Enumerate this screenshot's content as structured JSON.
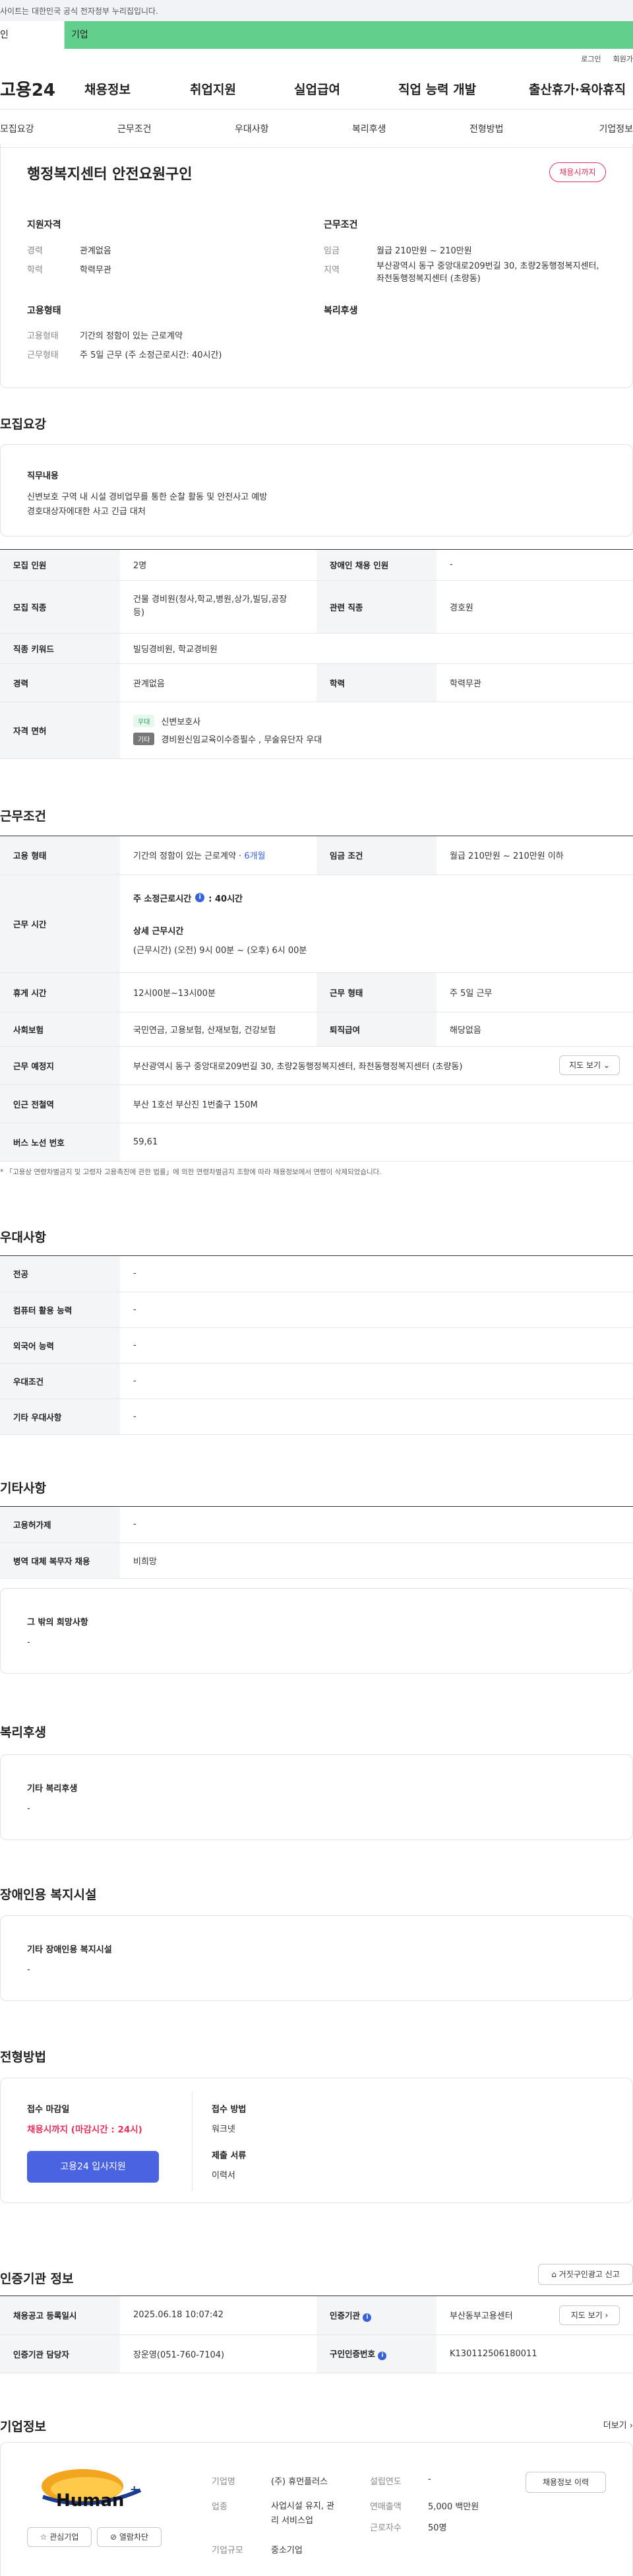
{
  "topbar": {
    "notice": "사이트는 대한민국 공식 전자정부 누리집입니다."
  },
  "gnb": {
    "tab1": "인",
    "tab2": "기업"
  },
  "util": {
    "login": "로그인",
    "join": "회원가"
  },
  "mainnav": {
    "logo": "고용24",
    "items": [
      "채용정보",
      "취업지원",
      "실업급여",
      "직업 능력 개발",
      "출산휴가·육아휴직"
    ]
  },
  "subnav": {
    "items": [
      "모집요강",
      "근무조건",
      "우대사항",
      "복리후생",
      "전형방법",
      "기업정보"
    ]
  },
  "job": {
    "title": "행정복지센터 안전요원구인",
    "badge": "채용시까지",
    "qual_head": "지원자격",
    "career_label": "경력",
    "career": "관계없음",
    "edu_label": "학력",
    "edu": "학력무관",
    "cond_head": "근무조건",
    "wage_label": "임금",
    "wage": "월급 210만원 ~ 210만원",
    "loc_label": "지역",
    "loc": "부산광역시 동구 중앙대로209번길 30, 초량2동행정복지센터, 좌천동행정복지센터 (초량동)",
    "emp_head": "고용형태",
    "emptype_label": "고용형태",
    "emptype": "기간의 정함이 있는 근로계약",
    "worktype_label": "근무형태",
    "worktype": "주 5일 근무 (주 소정근로시간: 40시간)",
    "welfare_head": "복리후생"
  },
  "recruit": {
    "title": "모집요강",
    "duty_head": "직무내용",
    "duty_line1": "신변보호 구역 내 시설 경비업무를 통한 순찰 활동 및 안전사고 예방",
    "duty_line2": "경호대상자에대한 사고 긴급 대처",
    "r1": {
      "k1": "모집 인원",
      "v1": "2명",
      "k2": "장애인 채용 인원",
      "v2": "-"
    },
    "r2": {
      "k1": "모집 직종",
      "v1a": "건물 경비원(청사,학교,병원,상가,빌딩,공장",
      "v1b": "등)",
      "k2": "관련 직종",
      "v2": "경호원"
    },
    "r3": {
      "k1": "직종 키워드",
      "v1": "빌딩경비원, 학교경비원"
    },
    "r4": {
      "k1": "경력",
      "v1": "관계없음",
      "k2": "학력",
      "v2": "학력무관"
    },
    "r5": {
      "k1": "자격 면허",
      "tag1": "우대",
      "lic1": "신변보호사",
      "tag2": "기타",
      "lic2": "경비원신임교육이수증필수 , 무술유단자 우대"
    }
  },
  "work": {
    "title": "근무조건",
    "r1": {
      "k1": "고용 형태",
      "v1": "기간의 정함이 있는 근로계약 · ",
      "v1b": "6개월",
      "k2": "임금 조건",
      "v2": "월급 210만원 ~ 210만원 이하"
    },
    "r2": {
      "k1": "근무 시간",
      "h1": "주 소정근로시간",
      "h1v": ": 40시간",
      "h2": "상세 근무시간",
      "h2v": "(근무시간) (오전) 9시 00분 ~ (오후) 6시 00분"
    },
    "r3": {
      "k1": "휴게 시간",
      "v1": "12시00분~13시00분",
      "k2": "근무 형태",
      "v2": "주 5일 근무"
    },
    "r4": {
      "k1": "사회보험",
      "v1": "국민연금, 고용보험, 산재보험, 건강보험",
      "k2": "퇴직급여",
      "v2": "해당없음"
    },
    "r5": {
      "k1": "근무 예정지",
      "v1": "부산광역시 동구 중앙대로209번길 30, 초량2동행정복지센터, 좌천동행정복지센터 (초량동)",
      "btn": "지도 보기"
    },
    "r6": {
      "k1": "인근 전철역",
      "v1": "부산 1호선 부산진 1번출구 150M"
    },
    "r7": {
      "k1": "버스 노선 번호",
      "v1": "59,61"
    },
    "note": "* 「고용상 연령차별금지 및 고령자 고용촉진에 관한 법률」에 의한 연령차별금지 조항에 따라 채용정보에서 연령이 삭제되었습니다."
  },
  "pref": {
    "title": "우대사항",
    "rows": [
      {
        "k": "전공",
        "v": "-"
      },
      {
        "k": "컴퓨터 활용 능력",
        "v": "-"
      },
      {
        "k": "외국어 능력",
        "v": "-"
      },
      {
        "k": "우대조건",
        "v": "-"
      },
      {
        "k": "기타 우대사항",
        "v": "-"
      }
    ]
  },
  "etc": {
    "title": "기타사항",
    "rows": [
      {
        "k": "고용허가제",
        "v": "-"
      },
      {
        "k": "병역 대체 복무자 채용",
        "v": "비희망"
      }
    ],
    "wish_head": "그 밖의 희망사항",
    "wish": "-"
  },
  "welfare": {
    "title": "복리후생",
    "head": "기타 복리후생",
    "value": "-"
  },
  "disab": {
    "title": "장애인용 복지시설",
    "head": "기타 장애인용 복지시설",
    "value": "-"
  },
  "selection": {
    "title": "전형방법",
    "deadline_head": "접수 마감일",
    "deadline": "채용시까지 (마감시간 : 24시)",
    "apply_btn": "고용24 입사지원",
    "method_head": "접수 방법",
    "method": "워크넷",
    "docs_head": "제출 서류",
    "docs": "이력서"
  },
  "cert": {
    "title": "인증기관 정보",
    "report_btn": "거짓구인광고 신고",
    "r1": {
      "k1": "채용공고 등록일시",
      "v1": "2025.06.18 10:07:42",
      "k2": "인증기관",
      "v2": "부산동부고용센터",
      "btn": "지도 보기"
    },
    "r2": {
      "k1": "인증기관 담당자",
      "v1": "장운영(051-760-7104)",
      "k2": "구인인증번호",
      "v2": "K130112506180011"
    }
  },
  "company": {
    "title": "기업정보",
    "more": "더보기",
    "logo_text": "Human",
    "fav_btn": "관심기업",
    "block_btn": "열람차단",
    "name_label": "기업명",
    "name": "(주) 휴먼플러스",
    "ind_label": "업종",
    "ind_a": "사업시설 유지, 관",
    "ind_b": "리 서비스업",
    "size_label": "기업규모",
    "size": "중소기업",
    "year_label": "설립연도",
    "year": "-",
    "sales_label": "연매출액",
    "sales": "5,000 백만원",
    "staff_label": "근로자수",
    "staff": "50명",
    "info_btn": "채용정보 이력"
  },
  "colors": {
    "green": "#6fd195",
    "accent_red": "#e5315a",
    "primary_blue": "#4a63e0",
    "link_blue": "#3a62d8"
  }
}
